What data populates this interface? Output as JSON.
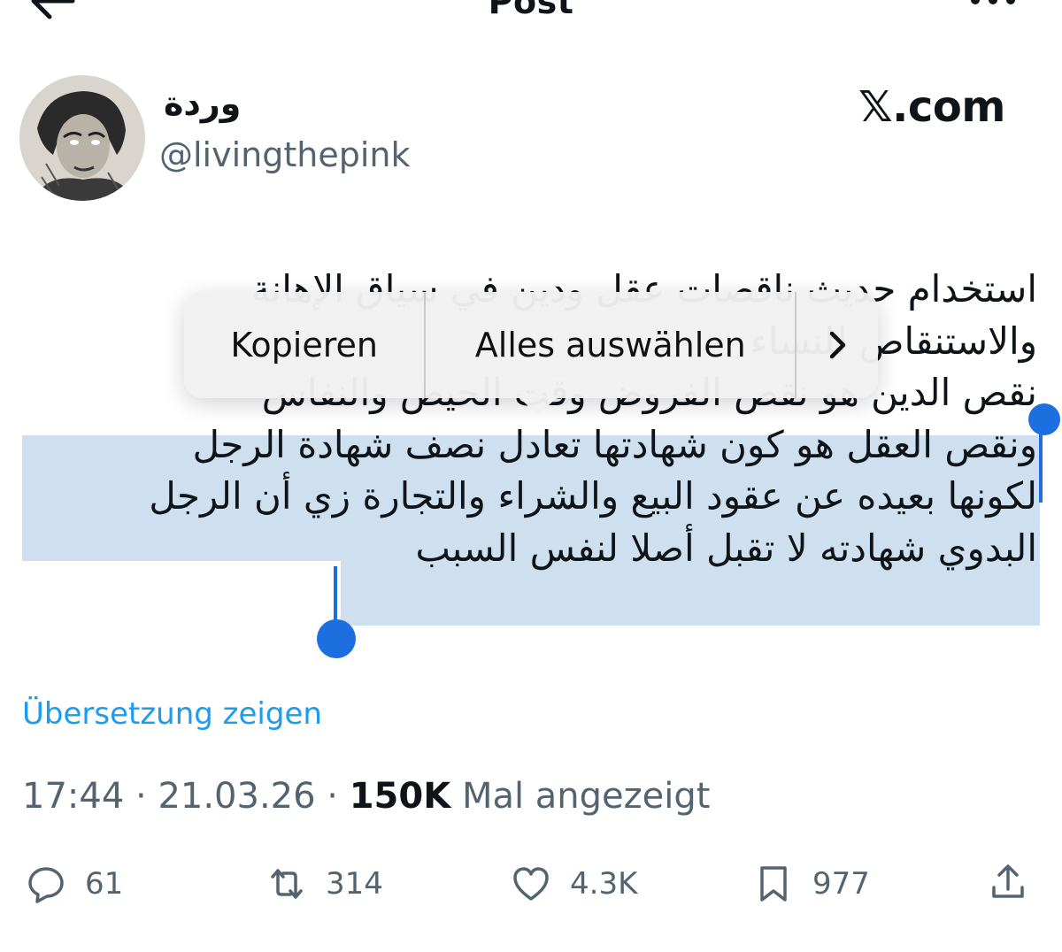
{
  "header": {
    "title": "Post",
    "back_icon": "back-arrow-icon",
    "more_icon": "more-icon"
  },
  "author": {
    "display_name": "وردة",
    "handle": "@livingthepink",
    "avatar": "avatar"
  },
  "brand": "𝕏.com",
  "tweet": {
    "lines": [
      "استخدام حديث ناقصات عقل ودين في سياق الإهانة",
      "والاستنقاص للنساء",
      "نقص الدين هو نقص الفروض وقت الحيض والنفاس",
      "ونقص العقل هو كون شهادتها تعادل نصف شهادة الرجل",
      "لكونها بعيده عن عقود البيع والشراء والتجارة زي أن الرجل",
      "البدوي شهادته لا تقبل أصلا لنفس السبب"
    ]
  },
  "context_menu": {
    "copy": "Kopieren",
    "select_all": "Alles auswählen",
    "next": "›"
  },
  "translate_link": "Übersetzung zeigen",
  "meta": {
    "time": "17:44",
    "date": "21.03.26",
    "views": "150K",
    "views_label": "Mal angezeigt",
    "separator": "·"
  },
  "actions": {
    "replies": "61",
    "reposts": "314",
    "likes": "4.3K",
    "bookmarks": "977"
  },
  "colors": {
    "accent": "#1d9bf0",
    "selection": "#cfe0f1",
    "handle": "#1d6fe0",
    "secondary_text": "#536471"
  }
}
